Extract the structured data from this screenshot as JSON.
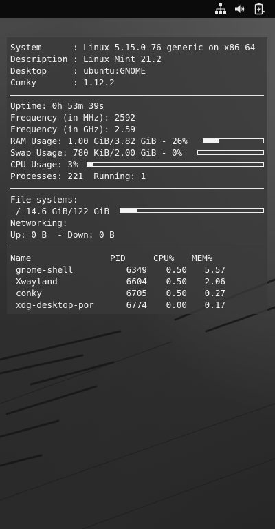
{
  "tray": {
    "icons": [
      "network-wired-icon",
      "volume-icon",
      "battery-charging-icon"
    ]
  },
  "system_info": [
    {
      "label": "System     ",
      "value": "Linux 5.15.0-76-generic on x86_64"
    },
    {
      "label": "Description",
      "value": "Linux Mint 21.2"
    },
    {
      "label": "Desktop    ",
      "value": "ubuntu:GNOME"
    },
    {
      "label": "Conky      ",
      "value": "1.12.2"
    }
  ],
  "stats": {
    "uptime_label": "Uptime:",
    "uptime_value": "0h 53m 39s",
    "freq_mhz_label": "Frequency (in MHz):",
    "freq_mhz_value": "2592",
    "freq_ghz_label": "Frequency (in GHz):",
    "freq_ghz_value": "2.59",
    "ram_label": "RAM Usage:",
    "ram_value": "1.00 GiB/3.82 GiB - 26%",
    "ram_fraction": 0.26,
    "swap_label": "Swap Usage:",
    "swap_value": "780 KiB/2.00 GiB - 0%",
    "swap_fraction": 0.0,
    "cpu_label": "CPU Usage:",
    "cpu_value": "3%",
    "cpu_fraction": 0.03,
    "processes_label": "Processes:",
    "processes_value": "221",
    "running_label": "Running:",
    "running_value": "1"
  },
  "filesystems": {
    "label": "File systems:",
    "root_value": " / 14.6 GiB/122 GiB",
    "root_fraction": 0.12
  },
  "networking": {
    "label": "Networking:",
    "up_label": "Up:",
    "up_value": "0 B",
    "down_label": "- Down:",
    "down_value": "0 B"
  },
  "processes": {
    "headers": {
      "name": "Name",
      "pid": "PID",
      "cpu": "CPU%",
      "mem": "MEM%"
    },
    "rows": [
      {
        "name": "gnome-shell",
        "pid": "6349",
        "cpu": "0.50",
        "mem": "5.57"
      },
      {
        "name": "Xwayland",
        "pid": "6604",
        "cpu": "0.50",
        "mem": "2.06"
      },
      {
        "name": "conky",
        "pid": "6705",
        "cpu": "0.50",
        "mem": "0.27"
      },
      {
        "name": "xdg-desktop-por",
        "pid": "6774",
        "cpu": "0.00",
        "mem": "0.17"
      }
    ]
  }
}
